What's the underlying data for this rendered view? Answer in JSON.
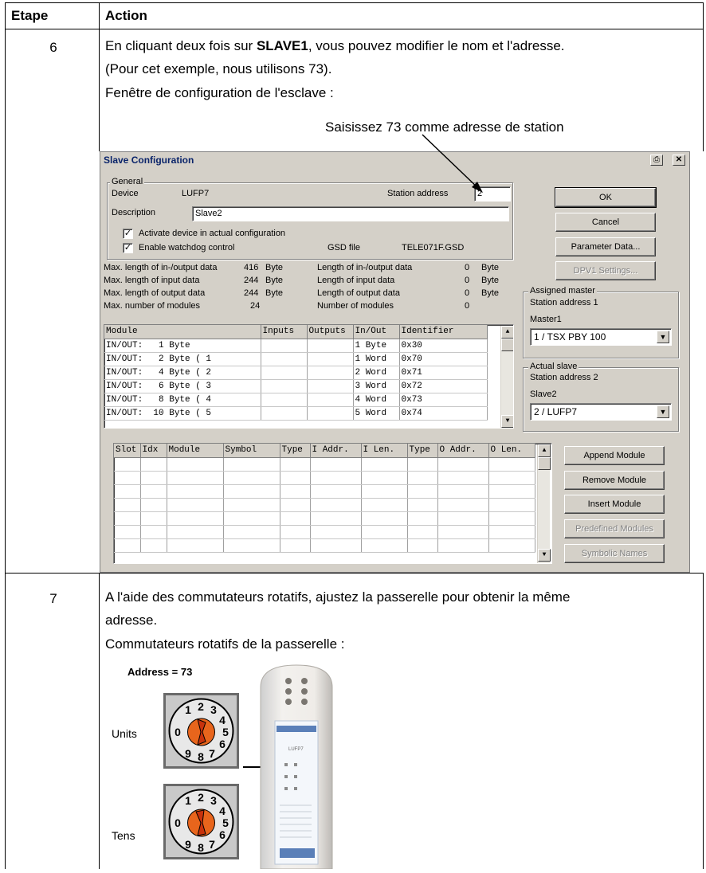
{
  "table": {
    "header_step": "Etape",
    "header_action": "Action"
  },
  "rows": [
    {
      "step": "6",
      "lines": [
        "En cliquant deux fois sur ",
        "SLAVE1",
        ", vous pouvez modifier le nom et l'adresse.",
        "(Pour cet exemple, nous utilisons 73).",
        "Fenêtre de configuration de l'esclave :"
      ],
      "callout": "Saisissez 73 comme adresse de station"
    },
    {
      "step": "7",
      "lines": [
        "A l'aide des commutateurs rotatifs, ajustez la passerelle pour obtenir la même",
        "adresse.",
        "Commutateurs rotatifs de la passerelle :"
      ]
    }
  ],
  "dialog": {
    "title": "Slave Configuration",
    "general_legend": "General",
    "device_label": "Device",
    "device_value": "LUFP7",
    "station_address_label": "Station address",
    "station_address_value": "2",
    "description_label": "Description",
    "description_value": "Slave2",
    "activate_label": "Activate device in actual configuration",
    "watchdog_label": "Enable watchdog control",
    "gsd_label": "GSD file",
    "gsd_value": "TELE071F.GSD",
    "stats": [
      {
        "l1": "Max. length of in-/output data",
        "v1": "416",
        "u1": "Byte",
        "l2": "Length of in-/output data",
        "v2": "0",
        "u2": "Byte"
      },
      {
        "l1": "Max. length of input data",
        "v1": "244",
        "u1": "Byte",
        "l2": "Length of input data",
        "v2": "0",
        "u2": "Byte"
      },
      {
        "l1": "Max. length of output data",
        "v1": "244",
        "u1": "Byte",
        "l2": "Length of output data",
        "v2": "0",
        "u2": "Byte"
      },
      {
        "l1": "Max. number of modules",
        "v1": "24",
        "u1": "",
        "l2": "Number of modules",
        "v2": "0",
        "u2": ""
      }
    ],
    "module_headers": [
      "Module",
      "Inputs",
      "Outputs",
      "In/Out",
      "Identifier"
    ],
    "modules": [
      [
        "IN/OUT:   1 Byte",
        "",
        "",
        "1 Byte",
        "0x30"
      ],
      [
        "IN/OUT:   2 Byte ( 1",
        "",
        "",
        "1 Word",
        "0x70"
      ],
      [
        "IN/OUT:   4 Byte ( 2",
        "",
        "",
        "2 Word",
        "0x71"
      ],
      [
        "IN/OUT:   6 Byte ( 3",
        "",
        "",
        "3 Word",
        "0x72"
      ],
      [
        "IN/OUT:   8 Byte ( 4",
        "",
        "",
        "4 Word",
        "0x73"
      ],
      [
        "IN/OUT:  10 Byte ( 5",
        "",
        "",
        "5 Word",
        "0x74"
      ]
    ],
    "slot_headers": [
      "Slot",
      "Idx",
      "Module",
      "Symbol",
      "Type",
      "I Addr.",
      "I Len.",
      "Type",
      "O Addr.",
      "O Len."
    ],
    "buttons": {
      "ok": "OK",
      "cancel": "Cancel",
      "parameter_data": "Parameter Data...",
      "dpv1_settings": "DPV1 Settings...",
      "append_module": "Append Module",
      "remove_module": "Remove Module",
      "insert_module": "Insert Module",
      "predefined_modules": "Predefined Modules",
      "symbolic_names": "Symbolic Names"
    },
    "assigned_master": {
      "legend": "Assigned master",
      "station": "Station address 1",
      "name": "Master1",
      "selected": "1 / TSX PBY 100"
    },
    "actual_slave": {
      "legend": "Actual slave",
      "station": "Station address 2",
      "name": "Slave2",
      "selected": "2 / LUFP7"
    }
  },
  "switches": {
    "title": "Address = 73",
    "units_label": "Units",
    "tens_label": "Tens",
    "device_label": "LUFP7"
  },
  "colors": {
    "dialog_face": "#d4d0c8",
    "title_text": "#0a246a",
    "dial_orange": "#e8651c"
  }
}
